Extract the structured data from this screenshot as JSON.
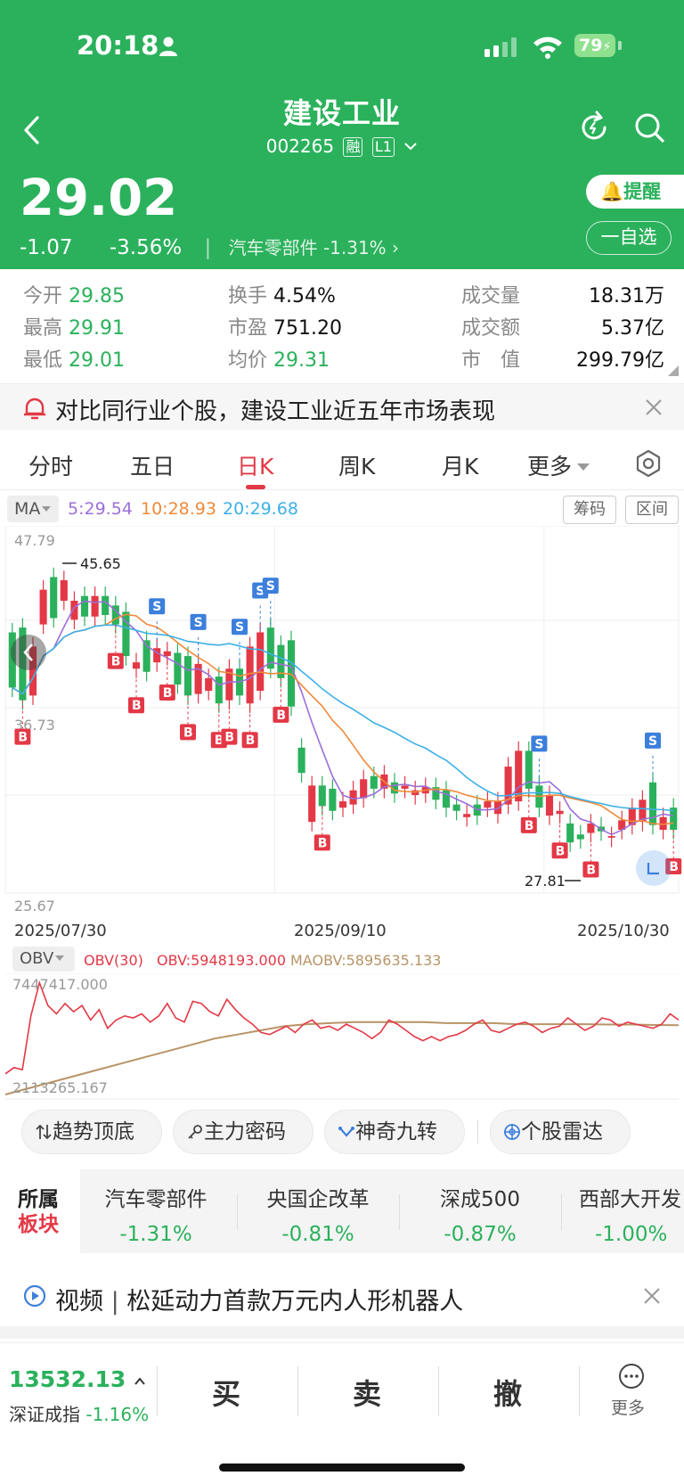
{
  "status": {
    "time": "20:18",
    "battery": "79"
  },
  "header": {
    "name": "建设工业",
    "code": "002265",
    "badge1": "融",
    "badge2": "L1"
  },
  "quote": {
    "price": "29.02",
    "change": "-1.07",
    "pct": "-3.56%",
    "industry": "汽车零部件",
    "industry_pct": "-1.31%",
    "remind": "提醒",
    "fav": "一自选"
  },
  "stats": {
    "open_k": "今开",
    "open_v": "29.85",
    "high_k": "最高",
    "high_v": "29.91",
    "low_k": "最低",
    "low_v": "29.01",
    "turnover_k": "换手",
    "turnover_v": "4.54%",
    "pe_k": "市盈",
    "pe_v": "751.20",
    "avg_k": "均价",
    "avg_v": "29.31",
    "vol_k": "成交量",
    "vol_v": "18.31万",
    "amt_k": "成交额",
    "amt_v": "5.37亿",
    "cap_k": "市　值",
    "cap_v": "299.79亿"
  },
  "banner": {
    "text": "对比同行业个股，建设工业近五年市场表现"
  },
  "tabs": [
    "分时",
    "五日",
    "日K",
    "周K",
    "月K",
    "更多"
  ],
  "ma": {
    "select": "MA",
    "ma5": "5:29.54",
    "ma10": "10:28.93",
    "ma20": "20:29.68",
    "btn1": "筹码",
    "btn2": "区间"
  },
  "chart_labels": {
    "y_top": "47.79",
    "y_mid": "36.73",
    "y_bottom": "25.67",
    "hi": "45.65",
    "lo": "27.81"
  },
  "obv": {
    "select": "OBV",
    "param": "OBV(30)",
    "obv": "OBV:5948193.000",
    "maobv": "MAOBV:5895635.133",
    "y_top": "7447417.000",
    "y_bottom": "2113265.167"
  },
  "tools": [
    "趋势顶底",
    "主力密码",
    "神奇九转",
    "个股雷达"
  ],
  "sectors": {
    "label1": "所属",
    "label2": "板块",
    "items": [
      {
        "name": "汽车零部件",
        "pct": "-1.31%"
      },
      {
        "name": "央国企改革",
        "pct": "-0.81%"
      },
      {
        "name": "深成500",
        "pct": "-0.87%"
      },
      {
        "name": "西部大开发",
        "pct": "-1.00%"
      }
    ]
  },
  "news": {
    "label": "视频",
    "text": "松延动力首款万元内人形机器人"
  },
  "bottom": {
    "index_val": "13532.13",
    "index_name": "深证成指",
    "index_pct": "-1.16%",
    "buy": "买",
    "sell": "卖",
    "cancel": "撤",
    "more": "更多"
  },
  "colors": {
    "green": "#2bb15c",
    "red": "#e33846",
    "ma5": "#9b6fd9",
    "ma10": "#f08a3a",
    "ma20": "#3cb0e8",
    "obv": "#e33846",
    "maobv": "#b89466"
  },
  "chart_data": [
    {
      "type": "candlestick",
      "x_tick_labels": [
        "2025/07/30",
        "2025/09/10",
        "2025/10/30"
      ],
      "ylim": [
        25.67,
        47.79
      ],
      "y_tick_labels": [
        "47.79",
        "36.73",
        "25.67"
      ],
      "indicators": {
        "MA5": "29.54",
        "MA10": "28.93",
        "MA20": "29.68"
      },
      "annotations": [
        "45.65",
        "27.81"
      ],
      "candles": [
        {
          "o": 41.5,
          "c": 38.0
        },
        {
          "o": 41.8,
          "c": 37.2
        },
        {
          "o": 37.5,
          "c": 40.6
        },
        {
          "o": 42.0,
          "c": 44.2
        },
        {
          "o": 45.0,
          "c": 42.4
        },
        {
          "o": 43.5,
          "c": 44.8
        },
        {
          "o": 42.3,
          "c": 43.5
        },
        {
          "o": 43.8,
          "c": 42.5
        },
        {
          "o": 42.5,
          "c": 43.8
        },
        {
          "o": 43.8,
          "c": 42.6
        },
        {
          "o": 43.2,
          "c": 42.0
        },
        {
          "o": 42.8,
          "c": 40.0
        },
        {
          "o": 39.2,
          "c": 39.6
        },
        {
          "o": 41.0,
          "c": 39.0
        },
        {
          "o": 39.6,
          "c": 40.5
        },
        {
          "o": 40.0,
          "c": 40.3
        },
        {
          "o": 40.2,
          "c": 38.2
        },
        {
          "o": 40.0,
          "c": 37.5
        },
        {
          "o": 37.6,
          "c": 39.5
        },
        {
          "o": 37.8,
          "c": 38.6
        },
        {
          "o": 38.7,
          "c": 37.0
        },
        {
          "o": 37.2,
          "c": 39.2
        },
        {
          "o": 39.2,
          "c": 37.5
        },
        {
          "o": 37.0,
          "c": 40.6
        },
        {
          "o": 37.8,
          "c": 41.5
        },
        {
          "o": 41.8,
          "c": 39.2
        },
        {
          "o": 40.7,
          "c": 38.6
        },
        {
          "o": 41.0,
          "c": 36.8
        },
        {
          "o": 34.2,
          "c": 32.6
        },
        {
          "o": 29.5,
          "c": 31.8
        },
        {
          "o": 31.8,
          "c": 30.5
        },
        {
          "o": 31.6,
          "c": 30.2
        },
        {
          "o": 30.4,
          "c": 30.8
        },
        {
          "o": 30.6,
          "c": 31.5
        },
        {
          "o": 31.0,
          "c": 32.2
        },
        {
          "o": 32.4,
          "c": 31.6
        },
        {
          "o": 31.6,
          "c": 32.5
        },
        {
          "o": 32.0,
          "c": 31.3
        },
        {
          "o": 31.6,
          "c": 31.8
        },
        {
          "o": 31.2,
          "c": 31.5
        },
        {
          "o": 31.3,
          "c": 31.7
        },
        {
          "o": 31.7,
          "c": 30.9
        },
        {
          "o": 31.5,
          "c": 30.4
        },
        {
          "o": 30.6,
          "c": 30.2
        },
        {
          "o": 29.8,
          "c": 30.0
        },
        {
          "o": 30.6,
          "c": 29.9
        },
        {
          "o": 30.4,
          "c": 30.8
        },
        {
          "o": 30.0,
          "c": 30.8
        },
        {
          "o": 30.6,
          "c": 33.0
        },
        {
          "o": 30.8,
          "c": 34.0
        },
        {
          "o": 34.0,
          "c": 31.6
        },
        {
          "o": 31.8,
          "c": 30.4
        },
        {
          "o": 29.9,
          "c": 31.2
        },
        {
          "o": 30.0,
          "c": 30.2
        },
        {
          "o": 29.4,
          "c": 28.2
        },
        {
          "o": 28.7,
          "c": 28.4
        },
        {
          "o": 28.8,
          "c": 29.4
        },
        {
          "o": 29.2,
          "c": 28.9
        },
        {
          "o": 28.5,
          "c": 28.6
        },
        {
          "o": 29.0,
          "c": 29.6
        },
        {
          "o": 29.3,
          "c": 30.4
        },
        {
          "o": 29.5,
          "c": 30.9
        },
        {
          "o": 32.0,
          "c": 29.3
        },
        {
          "o": 29.0,
          "c": 29.8
        },
        {
          "o": 30.4,
          "c": 29.0
        }
      ]
    },
    {
      "type": "line",
      "title": "OBV",
      "ylim": [
        2113265.167,
        7447417.0
      ],
      "series": [
        {
          "name": "OBV",
          "values": [
            3.0,
            3.3,
            3.2,
            5.8,
            7.4,
            6.3,
            5.9,
            6.4,
            6.0,
            6.3,
            5.6,
            6.1,
            5.2,
            5.6,
            5.8,
            5.7,
            5.9,
            5.5,
            5.8,
            6.4,
            5.7,
            5.5,
            6.5,
            6.4,
            6.0,
            5.8,
            6.6,
            6.1,
            5.7,
            5.4,
            5.0,
            4.9,
            5.1,
            5.3,
            5.0,
            5.4,
            5.6,
            5.2,
            5.3,
            5.1,
            5.4,
            5.2,
            5.0,
            4.7,
            5.0,
            5.6,
            5.4,
            5.1,
            4.8,
            4.6,
            4.8,
            4.6,
            4.8,
            4.9,
            5.1,
            5.4,
            5.6,
            5.1,
            5.0,
            5.2,
            5.4,
            5.5,
            5.3,
            5.0,
            5.2,
            5.3,
            5.7,
            5.4,
            5.1,
            5.3,
            5.7,
            5.6,
            5.3,
            5.5,
            5.4,
            5.3,
            5.2,
            5.4,
            5.9,
            5.6
          ]
        },
        {
          "name": "MAOBV",
          "values": [
            2.0,
            2.3,
            2.6,
            2.9,
            3.2,
            3.5,
            3.8,
            4.1,
            4.4,
            4.7,
            4.9,
            5.1,
            5.3,
            5.4,
            5.45,
            5.5,
            5.5,
            5.5,
            5.5,
            5.45,
            5.45,
            5.45,
            5.4,
            5.4,
            5.4,
            5.4,
            5.38,
            5.38,
            5.36,
            5.35
          ]
        }
      ]
    }
  ]
}
